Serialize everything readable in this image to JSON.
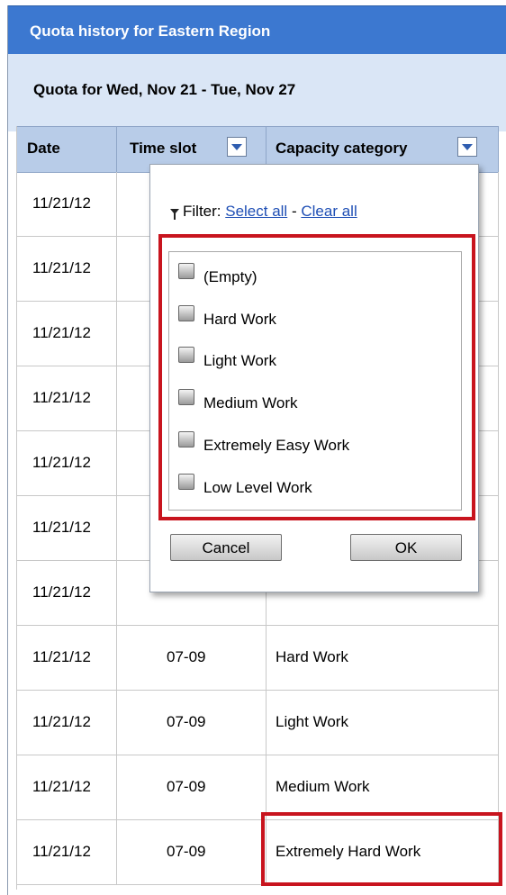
{
  "window": {
    "title": "Quota history for Eastern Region"
  },
  "subheader": {
    "text": "Quota for Wed, Nov 21 - Tue, Nov 27"
  },
  "table": {
    "columns": [
      "Date",
      "Time slot",
      "Capacity category"
    ],
    "rows": [
      {
        "date": "11/21/12",
        "slot": "",
        "category": ""
      },
      {
        "date": "11/21/12",
        "slot": "",
        "category": ""
      },
      {
        "date": "11/21/12",
        "slot": "",
        "category": ""
      },
      {
        "date": "11/21/12",
        "slot": "",
        "category": ""
      },
      {
        "date": "11/21/12",
        "slot": "",
        "category": ""
      },
      {
        "date": "11/21/12",
        "slot": "",
        "category": ""
      },
      {
        "date": "11/21/12",
        "slot": "",
        "category": ""
      },
      {
        "date": "11/21/12",
        "slot": "07-09",
        "category": "Hard Work"
      },
      {
        "date": "11/21/12",
        "slot": "07-09",
        "category": "Light Work"
      },
      {
        "date": "11/21/12",
        "slot": "07-09",
        "category": "Medium Work"
      },
      {
        "date": "11/21/12",
        "slot": "07-09",
        "category": "Extremely Hard Work"
      }
    ]
  },
  "filter_popup": {
    "filter_label": "Filter:",
    "select_all": "Select all",
    "separator": "-",
    "clear_all": "Clear all",
    "options": [
      "(Empty)",
      "Hard Work",
      "Light Work",
      "Medium Work",
      "Extremely Easy Work",
      "Low Level Work"
    ],
    "cancel_label": "Cancel",
    "ok_label": "OK"
  },
  "colors": {
    "titlebar": "#3c78d0",
    "subheader": "#dae6f6",
    "header_row": "#b8cce8",
    "highlight": "#c8141e",
    "link": "#1f4fb5"
  }
}
